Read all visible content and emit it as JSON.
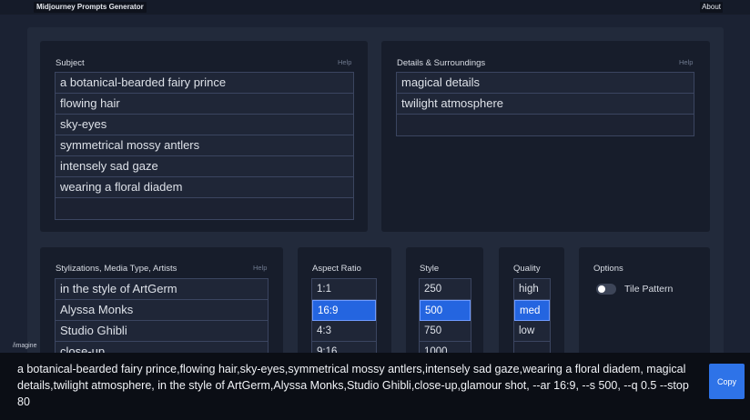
{
  "header": {
    "title": "Midjourney Prompts Generator",
    "about_label": "About"
  },
  "subject": {
    "label": "Subject",
    "help": "Help",
    "items": [
      "a botanical-bearded fairy prince",
      "flowing hair",
      "sky-eyes",
      "symmetrical mossy antlers",
      "intensely sad gaze",
      "wearing a floral diadem",
      ""
    ]
  },
  "details": {
    "label": "Details & Surroundings",
    "help": "Help",
    "items": [
      "magical details",
      "twilight atmosphere",
      ""
    ]
  },
  "stylizations": {
    "label": "Stylizations, Media Type, Artists",
    "help": "Help",
    "items": [
      "in the style of ArtGerm",
      "Alyssa Monks",
      "Studio Ghibli",
      "close-up"
    ]
  },
  "aspect_ratio": {
    "label": "Aspect Ratio",
    "options": [
      "1:1",
      "16:9",
      "4:3",
      "9:16"
    ],
    "selected": "16:9"
  },
  "style": {
    "label": "Style",
    "options": [
      "250",
      "500",
      "750",
      "1000"
    ],
    "selected": "500"
  },
  "quality": {
    "label": "Quality",
    "options": [
      "high",
      "med",
      "low",
      ""
    ],
    "selected": "med"
  },
  "options": {
    "label": "Options",
    "tile_pattern_label": "Tile Pattern",
    "tile_pattern_on": false
  },
  "output": {
    "imagine_label": "/imagine",
    "prompt": "a botanical-bearded fairy prince,flowing hair,sky-eyes,symmetrical mossy antlers,intensely sad gaze,wearing a floral diadem, magical details,twilight atmosphere, in the style of ArtGerm,Alyssa Monks,Studio Ghibli,close-up,glamour shot, --ar 16:9, --s 500, --q 0.5 --stop 80",
    "copy_label": "Copy"
  },
  "colors": {
    "background": "#1b2233",
    "panel": "#171d2b",
    "selected": "#2465e0",
    "copy_button": "#2e73e8"
  }
}
